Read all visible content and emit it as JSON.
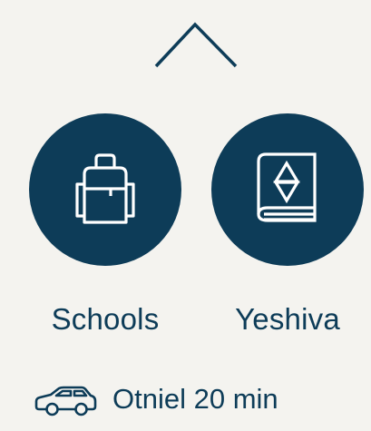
{
  "colors": {
    "background": "#f4f3ef",
    "accent": "#0d3c58",
    "icon_stroke": "#ffffff"
  },
  "collapse": {
    "icon": "chevron-up-icon"
  },
  "categories": [
    {
      "label": "Schools",
      "icon": "backpack-icon"
    },
    {
      "label": "Yeshiva",
      "icon": "star-of-david-book-icon"
    }
  ],
  "commute": {
    "icon": "car-icon",
    "text": "Otniel 20 min"
  }
}
